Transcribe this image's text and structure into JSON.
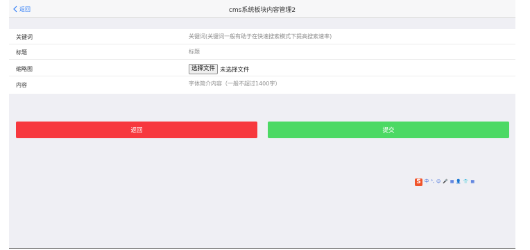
{
  "header": {
    "back_label": "返回",
    "title": "cms系统板块内容管理2"
  },
  "form": {
    "keyword": {
      "label": "关键词",
      "placeholder": "关键词(关键词一般有助于在快速搜索模式下提高搜索速率)"
    },
    "title": {
      "label": "标题",
      "placeholder": "标题"
    },
    "thumbnail": {
      "label": "缩略图",
      "button_label": "选择文件",
      "status": "未选择文件"
    },
    "content": {
      "label": "内容",
      "placeholder": "字体简介内容（一般不超过1400字）"
    }
  },
  "actions": {
    "back_label": "返回",
    "submit_label": "提交",
    "back_color": "#f7383e",
    "submit_color": "#4cd964"
  },
  "ime_toolbar": {
    "logo": "S",
    "items": [
      "中",
      "°,",
      "☺",
      "🎤",
      "▦",
      "👤",
      "👕",
      "▦"
    ]
  }
}
